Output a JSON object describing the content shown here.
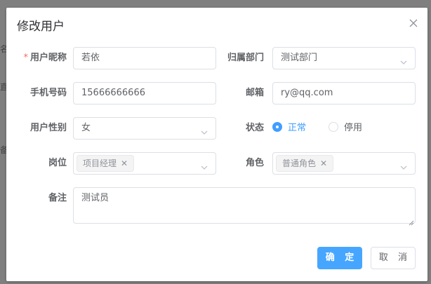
{
  "dialog": {
    "title": "修改用户",
    "close_icon": "close-icon"
  },
  "form": {
    "nickname": {
      "label": "用户昵称",
      "required_mark": "*",
      "value": "若依"
    },
    "dept": {
      "label": "归属部门",
      "value": "测试部门"
    },
    "phone": {
      "label": "手机号码",
      "value": "15666666666"
    },
    "email": {
      "label": "邮箱",
      "value": "ry@qq.com"
    },
    "sex": {
      "label": "用户性别",
      "value": "女"
    },
    "status": {
      "label": "状态",
      "options": [
        "正常",
        "停用"
      ],
      "selected": "正常"
    },
    "post": {
      "label": "岗位",
      "tags": [
        "项目经理"
      ]
    },
    "role": {
      "label": "角色",
      "tags": [
        "普通角色"
      ]
    },
    "remark": {
      "label": "备注",
      "value": "测试员"
    }
  },
  "footer": {
    "confirm_label": "确 定",
    "cancel_label": "取 消"
  },
  "background": {
    "edge_fragments": [
      "名",
      "直",
      "备"
    ]
  },
  "colors": {
    "primary": "#46a6ff",
    "required": "#f56c6c",
    "radio_checked": "#409eff"
  }
}
